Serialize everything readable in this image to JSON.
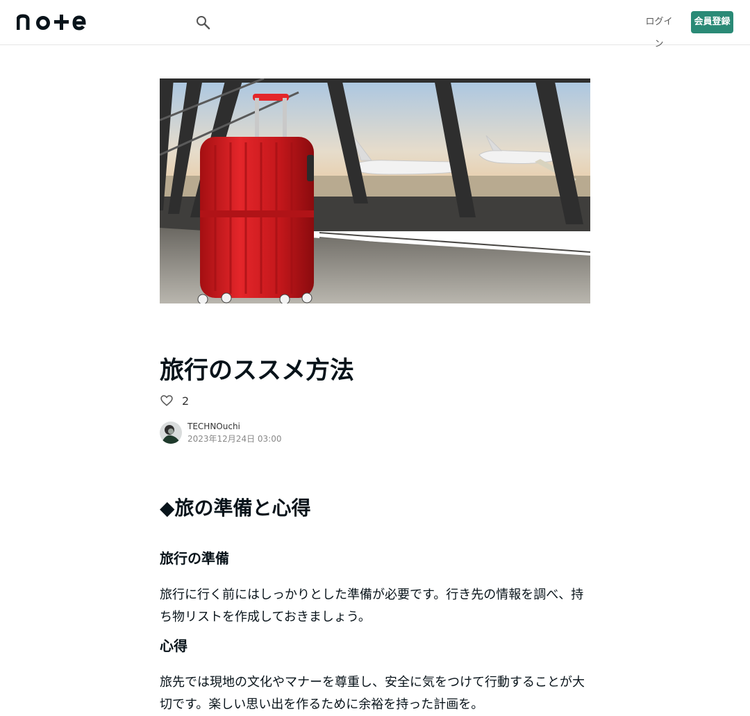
{
  "header": {
    "logo_text": "note",
    "search_icon": "search-icon",
    "login_label": "ログイン",
    "signup_label": "会員登録"
  },
  "hero": {
    "image": "red-suitcase-at-airport-illustration"
  },
  "article": {
    "title": "旅行のススメ方法",
    "like_icon": "heart-icon",
    "like_count": "2",
    "author": {
      "name": "TECHNOuchi",
      "date": "2023年12月24日 03:00"
    },
    "section_heading": "◆旅の準備と心得",
    "subsections": [
      {
        "heading": "旅行の準備",
        "body": "旅行に行く前にはしっかりとした準備が必要です。行き先の情報を調べ、持ち物リストを作成しておきましょう。"
      },
      {
        "heading": "心得",
        "body": "旅先では現地の文化やマナーを尊重し、安全に気をつけて行動することが大切です。楽しい思い出を作るために余裕を持った計画を。"
      }
    ]
  },
  "colors": {
    "accent": "#2a8a76",
    "text": "#08131a",
    "suitcase": "#d8191c"
  }
}
